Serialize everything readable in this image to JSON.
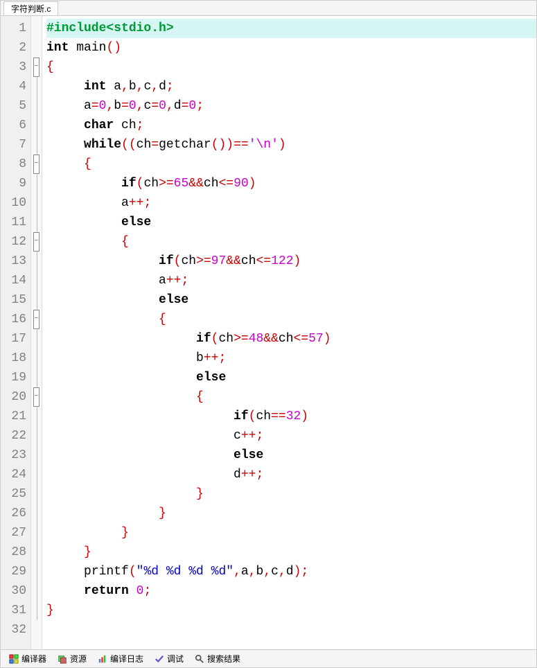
{
  "tab": {
    "title": "字符判断.c"
  },
  "code": {
    "lines": [
      {
        "n": 1,
        "fold": "",
        "hl": true,
        "frags": [
          {
            "t": "#include<stdio.h>",
            "c": "pp"
          }
        ]
      },
      {
        "n": 2,
        "fold": "",
        "frags": [
          {
            "t": "int",
            "c": "kw"
          },
          {
            "t": " ",
            "c": "id"
          },
          {
            "t": "main",
            "c": "id"
          },
          {
            "t": "()",
            "c": "br"
          }
        ]
      },
      {
        "n": 3,
        "fold": "box",
        "frags": [
          {
            "indent": 0
          },
          {
            "t": "{",
            "c": "br"
          }
        ]
      },
      {
        "n": 4,
        "fold": "v",
        "frags": [
          {
            "indent": 1
          },
          {
            "t": "int",
            "c": "kw"
          },
          {
            "t": " a",
            "c": "id"
          },
          {
            "t": ",",
            "c": "op"
          },
          {
            "t": "b",
            "c": "id"
          },
          {
            "t": ",",
            "c": "op"
          },
          {
            "t": "c",
            "c": "id"
          },
          {
            "t": ",",
            "c": "op"
          },
          {
            "t": "d",
            "c": "id"
          },
          {
            "t": ";",
            "c": "op"
          }
        ]
      },
      {
        "n": 5,
        "fold": "v",
        "frags": [
          {
            "indent": 1
          },
          {
            "t": "a",
            "c": "id"
          },
          {
            "t": "=",
            "c": "op"
          },
          {
            "t": "0",
            "c": "num"
          },
          {
            "t": ",",
            "c": "op"
          },
          {
            "t": "b",
            "c": "id"
          },
          {
            "t": "=",
            "c": "op"
          },
          {
            "t": "0",
            "c": "num"
          },
          {
            "t": ",",
            "c": "op"
          },
          {
            "t": "c",
            "c": "id"
          },
          {
            "t": "=",
            "c": "op"
          },
          {
            "t": "0",
            "c": "num"
          },
          {
            "t": ",",
            "c": "op"
          },
          {
            "t": "d",
            "c": "id"
          },
          {
            "t": "=",
            "c": "op"
          },
          {
            "t": "0",
            "c": "num"
          },
          {
            "t": ";",
            "c": "op"
          }
        ]
      },
      {
        "n": 6,
        "fold": "v",
        "frags": [
          {
            "indent": 1
          },
          {
            "t": "char",
            "c": "kw"
          },
          {
            "t": " ch",
            "c": "id"
          },
          {
            "t": ";",
            "c": "op"
          }
        ]
      },
      {
        "n": 7,
        "fold": "v",
        "frags": [
          {
            "indent": 1
          },
          {
            "t": "while",
            "c": "kw"
          },
          {
            "t": "((",
            "c": "br"
          },
          {
            "t": "ch",
            "c": "id"
          },
          {
            "t": "=",
            "c": "op"
          },
          {
            "t": "getchar",
            "c": "id"
          },
          {
            "t": "())==",
            "c": "br"
          },
          {
            "t": "'\\n'",
            "c": "num"
          },
          {
            "t": ")",
            "c": "br"
          }
        ]
      },
      {
        "n": 8,
        "fold": "box",
        "frags": [
          {
            "indent": 1
          },
          {
            "t": "{",
            "c": "br"
          }
        ]
      },
      {
        "n": 9,
        "fold": "v",
        "frags": [
          {
            "indent": 2
          },
          {
            "t": "if",
            "c": "kw"
          },
          {
            "t": "(",
            "c": "br"
          },
          {
            "t": "ch",
            "c": "id"
          },
          {
            "t": ">=",
            "c": "op"
          },
          {
            "t": "65",
            "c": "num"
          },
          {
            "t": "&&",
            "c": "op"
          },
          {
            "t": "ch",
            "c": "id"
          },
          {
            "t": "<=",
            "c": "op"
          },
          {
            "t": "90",
            "c": "num"
          },
          {
            "t": ")",
            "c": "br"
          }
        ]
      },
      {
        "n": 10,
        "fold": "v",
        "frags": [
          {
            "indent": 2
          },
          {
            "t": "a",
            "c": "id"
          },
          {
            "t": "++;",
            "c": "op"
          }
        ]
      },
      {
        "n": 11,
        "fold": "v",
        "frags": [
          {
            "indent": 2
          },
          {
            "t": "else",
            "c": "kw"
          }
        ]
      },
      {
        "n": 12,
        "fold": "box",
        "frags": [
          {
            "indent": 2
          },
          {
            "t": "{",
            "c": "br"
          }
        ]
      },
      {
        "n": 13,
        "fold": "v",
        "frags": [
          {
            "indent": 3
          },
          {
            "t": "if",
            "c": "kw"
          },
          {
            "t": "(",
            "c": "br"
          },
          {
            "t": "ch",
            "c": "id"
          },
          {
            "t": ">=",
            "c": "op"
          },
          {
            "t": "97",
            "c": "num"
          },
          {
            "t": "&&",
            "c": "op"
          },
          {
            "t": "ch",
            "c": "id"
          },
          {
            "t": "<=",
            "c": "op"
          },
          {
            "t": "122",
            "c": "num"
          },
          {
            "t": ")",
            "c": "br"
          }
        ]
      },
      {
        "n": 14,
        "fold": "v",
        "frags": [
          {
            "indent": 3
          },
          {
            "t": "a",
            "c": "id"
          },
          {
            "t": "++;",
            "c": "op"
          }
        ]
      },
      {
        "n": 15,
        "fold": "v",
        "frags": [
          {
            "indent": 3
          },
          {
            "t": "else",
            "c": "kw"
          }
        ]
      },
      {
        "n": 16,
        "fold": "box",
        "frags": [
          {
            "indent": 3
          },
          {
            "t": "{",
            "c": "br"
          }
        ]
      },
      {
        "n": 17,
        "fold": "v",
        "frags": [
          {
            "indent": 4
          },
          {
            "t": "if",
            "c": "kw"
          },
          {
            "t": "(",
            "c": "br"
          },
          {
            "t": "ch",
            "c": "id"
          },
          {
            "t": ">=",
            "c": "op"
          },
          {
            "t": "48",
            "c": "num"
          },
          {
            "t": "&&",
            "c": "op"
          },
          {
            "t": "ch",
            "c": "id"
          },
          {
            "t": "<=",
            "c": "op"
          },
          {
            "t": "57",
            "c": "num"
          },
          {
            "t": ")",
            "c": "br"
          }
        ]
      },
      {
        "n": 18,
        "fold": "v",
        "frags": [
          {
            "indent": 4
          },
          {
            "t": "b",
            "c": "id"
          },
          {
            "t": "++;",
            "c": "op"
          }
        ]
      },
      {
        "n": 19,
        "fold": "v",
        "frags": [
          {
            "indent": 4
          },
          {
            "t": "else",
            "c": "kw"
          }
        ]
      },
      {
        "n": 20,
        "fold": "box",
        "frags": [
          {
            "indent": 4
          },
          {
            "t": "{",
            "c": "br"
          }
        ]
      },
      {
        "n": 21,
        "fold": "v",
        "frags": [
          {
            "indent": 5
          },
          {
            "t": "if",
            "c": "kw"
          },
          {
            "t": "(",
            "c": "br"
          },
          {
            "t": "ch",
            "c": "id"
          },
          {
            "t": "==",
            "c": "op"
          },
          {
            "t": "32",
            "c": "num"
          },
          {
            "t": ")",
            "c": "br"
          }
        ]
      },
      {
        "n": 22,
        "fold": "v",
        "frags": [
          {
            "indent": 5
          },
          {
            "t": "c",
            "c": "id"
          },
          {
            "t": "++;",
            "c": "op"
          }
        ]
      },
      {
        "n": 23,
        "fold": "v",
        "frags": [
          {
            "indent": 5
          },
          {
            "t": "else",
            "c": "kw"
          }
        ]
      },
      {
        "n": 24,
        "fold": "v",
        "frags": [
          {
            "indent": 5
          },
          {
            "t": "d",
            "c": "id"
          },
          {
            "t": "++;",
            "c": "op"
          }
        ]
      },
      {
        "n": 25,
        "fold": "v",
        "frags": [
          {
            "indent": 4
          },
          {
            "t": "}",
            "c": "br"
          }
        ]
      },
      {
        "n": 26,
        "fold": "v",
        "frags": [
          {
            "indent": 3
          },
          {
            "t": "}",
            "c": "br"
          }
        ]
      },
      {
        "n": 27,
        "fold": "v",
        "frags": [
          {
            "indent": 2
          },
          {
            "t": "}",
            "c": "br"
          }
        ]
      },
      {
        "n": 28,
        "fold": "v",
        "frags": [
          {
            "indent": 1
          },
          {
            "t": "}",
            "c": "br"
          }
        ]
      },
      {
        "n": 29,
        "fold": "v",
        "frags": [
          {
            "indent": 1
          },
          {
            "t": "printf",
            "c": "id"
          },
          {
            "t": "(",
            "c": "br"
          },
          {
            "t": "\"%d %d %d %d\"",
            "c": "str"
          },
          {
            "t": ",",
            "c": "op"
          },
          {
            "t": "a",
            "c": "id"
          },
          {
            "t": ",",
            "c": "op"
          },
          {
            "t": "b",
            "c": "id"
          },
          {
            "t": ",",
            "c": "op"
          },
          {
            "t": "c",
            "c": "id"
          },
          {
            "t": ",",
            "c": "op"
          },
          {
            "t": "d",
            "c": "id"
          },
          {
            "t": ");",
            "c": "br"
          }
        ]
      },
      {
        "n": 30,
        "fold": "v",
        "frags": [
          {
            "indent": 1
          },
          {
            "t": "return",
            "c": "kw"
          },
          {
            "t": " ",
            "c": "id"
          },
          {
            "t": "0",
            "c": "num"
          },
          {
            "t": ";",
            "c": "op"
          }
        ]
      },
      {
        "n": 31,
        "fold": "end",
        "frags": [
          {
            "indent": 0
          },
          {
            "t": "}",
            "c": "br"
          }
        ]
      },
      {
        "n": 32,
        "fold": "",
        "frags": []
      }
    ]
  },
  "bottombar": {
    "items": [
      {
        "icon": "grid",
        "label": "编译器"
      },
      {
        "icon": "stack",
        "label": "资源"
      },
      {
        "icon": "chart",
        "label": "编译日志"
      },
      {
        "icon": "check",
        "label": "调试"
      },
      {
        "icon": "search",
        "label": "搜索结果"
      }
    ]
  }
}
